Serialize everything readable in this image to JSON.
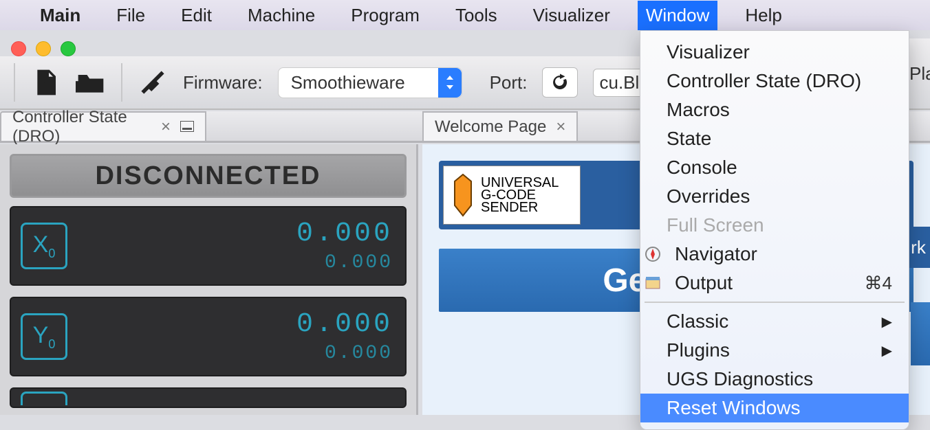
{
  "menubar": {
    "items": [
      "Main",
      "File",
      "Edit",
      "Machine",
      "Program",
      "Tools",
      "Visualizer",
      "Window",
      "Help"
    ],
    "active": "Window"
  },
  "toolbar": {
    "firmware_label": "Firmware:",
    "firmware_value": "Smoothieware",
    "port_label": "Port:",
    "port_value": "cu.Blu"
  },
  "tabs": {
    "left": "Controller State (DRO)",
    "right": "Welcome Page"
  },
  "dro": {
    "status": "DISCONNECTED",
    "axes": [
      {
        "name": "X",
        "sub": "0",
        "big": "0.000",
        "small": "0.000"
      },
      {
        "name": "Y",
        "sub": "0",
        "big": "0.000",
        "small": "0.000"
      }
    ]
  },
  "welcome": {
    "logo_l1": "UNIVERSAL",
    "logo_l2": "G-CODE",
    "logo_l3": "SENDER",
    "title": "Getting S",
    "side_label": "rk"
  },
  "dropdown": {
    "items": [
      {
        "label": "Visualizer"
      },
      {
        "label": "Controller State (DRO)"
      },
      {
        "label": "Macros"
      },
      {
        "label": "State"
      },
      {
        "label": "Console"
      },
      {
        "label": "Overrides"
      },
      {
        "label": "Full Screen",
        "disabled": true
      },
      {
        "label": "Navigator",
        "icon": "compass"
      },
      {
        "label": "Output",
        "icon": "output",
        "shortcut": "⌘4"
      }
    ],
    "items2": [
      {
        "label": "Classic",
        "submenu": true
      },
      {
        "label": "Plugins",
        "submenu": true
      },
      {
        "label": "UGS Diagnostics"
      },
      {
        "label": "Reset Windows",
        "highlight": true
      }
    ]
  },
  "truncated_right": "Plat"
}
